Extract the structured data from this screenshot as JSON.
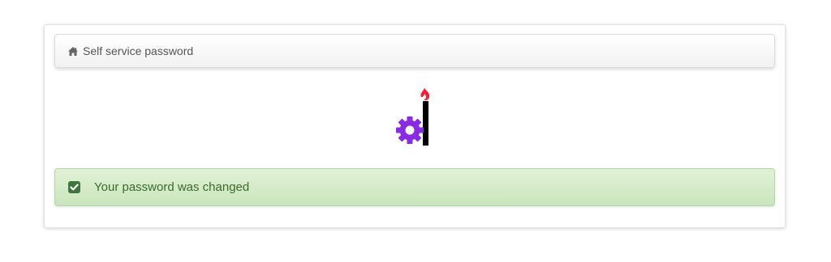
{
  "header": {
    "icon": "home-icon",
    "title": "Self service password"
  },
  "logo": {
    "icon": "ltb-logo-gear-flame-icon",
    "colors": {
      "gear": "#8a2be2",
      "bar": "#000000",
      "flame": "#ee2233"
    }
  },
  "alert": {
    "type": "success",
    "icon": "check-square-icon",
    "message": "Your password was changed",
    "colors": {
      "background": "#dff0d8",
      "text": "#3c763d"
    }
  }
}
